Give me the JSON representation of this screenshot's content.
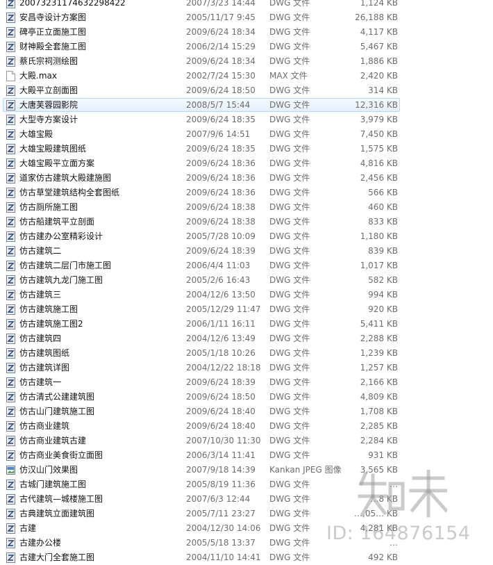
{
  "files": [
    {
      "name": "20073231174632298422",
      "date": "2007/3/23 14:44",
      "type": "DWG 文件",
      "size": "1,124 KB",
      "icon": "dwg-file-icon"
    },
    {
      "name": "安昌寺设计方案图",
      "date": "2005/11/17 9:45",
      "type": "DWG 文件",
      "size": "26,188 KB",
      "icon": "dwg-file-icon"
    },
    {
      "name": "碑亭正立面施工图",
      "date": "2009/6/24 18:34",
      "type": "DWG 文件",
      "size": "4,117 KB",
      "icon": "dwg-file-icon"
    },
    {
      "name": "财神殿全套施工图",
      "date": "2006/2/14 15:29",
      "type": "DWG 文件",
      "size": "5,467 KB",
      "icon": "dwg-file-icon"
    },
    {
      "name": "蔡氏宗祠测绘图",
      "date": "2009/6/24 18:34",
      "type": "DWG 文件",
      "size": "1,886 KB",
      "icon": "dwg-file-icon"
    },
    {
      "name": "大殿.max",
      "date": "2002/7/24 15:30",
      "type": "MAX 文件",
      "size": "2,420 KB",
      "icon": "blank-file-icon"
    },
    {
      "name": "大殿平立剖面图",
      "date": "2009/6/24 18:50",
      "type": "DWG 文件",
      "size": "314 KB",
      "icon": "dwg-file-icon"
    },
    {
      "name": "大唐芙蓉园影院",
      "date": "2008/5/7 15:44",
      "type": "DWG 文件",
      "size": "12,316 KB",
      "icon": "dwg-file-icon",
      "selected": true
    },
    {
      "name": "大型寺方案设计",
      "date": "2009/6/24 18:35",
      "type": "DWG 文件",
      "size": "3,979 KB",
      "icon": "dwg-file-icon"
    },
    {
      "name": "大雄宝殿",
      "date": "2007/9/6 14:51",
      "type": "DWG 文件",
      "size": "7,450 KB",
      "icon": "dwg-file-icon"
    },
    {
      "name": "大雄宝殿建筑图纸",
      "date": "2009/6/24 18:35",
      "type": "DWG 文件",
      "size": "1,575 KB",
      "icon": "dwg-file-icon"
    },
    {
      "name": "大雄宝殿平立面方案",
      "date": "2009/6/24 18:36",
      "type": "DWG 文件",
      "size": "4,816 KB",
      "icon": "dwg-file-icon"
    },
    {
      "name": "道家仿古建筑大殿建施图",
      "date": "2009/6/24 18:36",
      "type": "DWG 文件",
      "size": "2,456 KB",
      "icon": "dwg-file-icon"
    },
    {
      "name": "仿古草堂建筑结构全套图纸",
      "date": "2009/6/24 18:36",
      "type": "DWG 文件",
      "size": "566 KB",
      "icon": "dwg-file-icon"
    },
    {
      "name": "仿古厕所施工图",
      "date": "2009/6/24 18:38",
      "type": "DWG 文件",
      "size": "460 KB",
      "icon": "dwg-file-icon"
    },
    {
      "name": "仿古船建筑平立剖面",
      "date": "2009/6/24 18:38",
      "type": "DWG 文件",
      "size": "833 KB",
      "icon": "dwg-file-icon"
    },
    {
      "name": "仿古建办公室精彩设计",
      "date": "2005/7/28 10:09",
      "type": "DWG 文件",
      "size": "1,180 KB",
      "icon": "dwg-file-icon"
    },
    {
      "name": "仿古建筑二",
      "date": "2009/6/24 18:39",
      "type": "DWG 文件",
      "size": "839 KB",
      "icon": "dwg-file-icon"
    },
    {
      "name": "仿古建筑二层门市施工图",
      "date": "2006/4/4 11:03",
      "type": "DWG 文件",
      "size": "1,017 KB",
      "icon": "dwg-file-icon"
    },
    {
      "name": "仿古建筑九龙门施工图",
      "date": "2005/2/6 16:43",
      "type": "DWG 文件",
      "size": "582 KB",
      "icon": "dwg-file-icon"
    },
    {
      "name": "仿古建筑三",
      "date": "2004/12/6 13:50",
      "type": "DWG 文件",
      "size": "994 KB",
      "icon": "dwg-file-icon"
    },
    {
      "name": "仿古建筑施工图",
      "date": "2005/12/29 11:47",
      "type": "DWG 文件",
      "size": "920 KB",
      "icon": "dwg-file-icon"
    },
    {
      "name": "仿古建筑施工图2",
      "date": "2006/1/11 16:11",
      "type": "DWG 文件",
      "size": "5,411 KB",
      "icon": "dwg-file-icon"
    },
    {
      "name": "仿古建筑四",
      "date": "2004/12/6 13:49",
      "type": "DWG 文件",
      "size": "2,288 KB",
      "icon": "dwg-file-icon"
    },
    {
      "name": "仿古建筑图纸",
      "date": "2005/1/18 10:26",
      "type": "DWG 文件",
      "size": "1,239 KB",
      "icon": "dwg-file-icon"
    },
    {
      "name": "仿古建筑详图",
      "date": "2004/12/22 18:18",
      "type": "DWG 文件",
      "size": "1,257 KB",
      "icon": "dwg-file-icon"
    },
    {
      "name": "仿古建筑一",
      "date": "2009/6/24 18:39",
      "type": "DWG 文件",
      "size": "2,166 KB",
      "icon": "dwg-file-icon"
    },
    {
      "name": "仿古清式公建建筑图",
      "date": "2009/6/24 18:50",
      "type": "DWG 文件",
      "size": "4,809 KB",
      "icon": "dwg-file-icon"
    },
    {
      "name": "仿古山门建筑施工图",
      "date": "2009/6/24 18:40",
      "type": "DWG 文件",
      "size": "1,708 KB",
      "icon": "dwg-file-icon"
    },
    {
      "name": "仿古商业建筑",
      "date": "2009/6/24 18:40",
      "type": "DWG 文件",
      "size": "2,285 KB",
      "icon": "dwg-file-icon"
    },
    {
      "name": "仿古商业建筑古建",
      "date": "2007/10/30 11:30",
      "type": "DWG 文件",
      "size": "2,284 KB",
      "icon": "dwg-file-icon"
    },
    {
      "name": "仿古商业美食街立面图",
      "date": "2006/3/14 11:41",
      "type": "DWG 文件",
      "size": "931 KB",
      "icon": "dwg-file-icon"
    },
    {
      "name": "仿汉山门效果图",
      "date": "2007/9/18 14:39",
      "type": "Kankan JPEG 图像",
      "size": "3,565 KB",
      "icon": "jpeg-image-icon"
    },
    {
      "name": "古城门建筑施工图",
      "date": "2005/8/19 11:36",
      "type": "DWG 文件",
      "size": "…",
      "icon": "dwg-file-icon"
    },
    {
      "name": "古代建筑—城楼施工图",
      "date": "2007/6/3 12:44",
      "type": "DWG 文件",
      "size": "…8 KB",
      "icon": "dwg-file-icon"
    },
    {
      "name": "古典建筑立面建筑图",
      "date": "2005/7/11 23:27",
      "type": "DWG 文件",
      "size": "…,05… KB",
      "icon": "dwg-file-icon"
    },
    {
      "name": "古建",
      "date": "2004/12/30 14:06",
      "type": "DWG 文件",
      "size": "4,281 KB",
      "icon": "dwg-file-icon"
    },
    {
      "name": "古建办公楼",
      "date": "2005/5/18 13:37",
      "type": "DWG 文件",
      "size": "…",
      "icon": "dwg-file-icon"
    },
    {
      "name": "古建大门全套施工图",
      "date": "2004/11/10 14:41",
      "type": "DWG 文件",
      "size": "492 KB",
      "icon": "dwg-file-icon"
    }
  ],
  "watermark": {
    "logo_text": "知末",
    "id_text": "ID: 164876154"
  },
  "colors": {
    "selection_border": "#b8d6fb",
    "selection_fill": "#e5effc",
    "secondary_text": "#6d6d6d",
    "watermark": "#999999"
  }
}
